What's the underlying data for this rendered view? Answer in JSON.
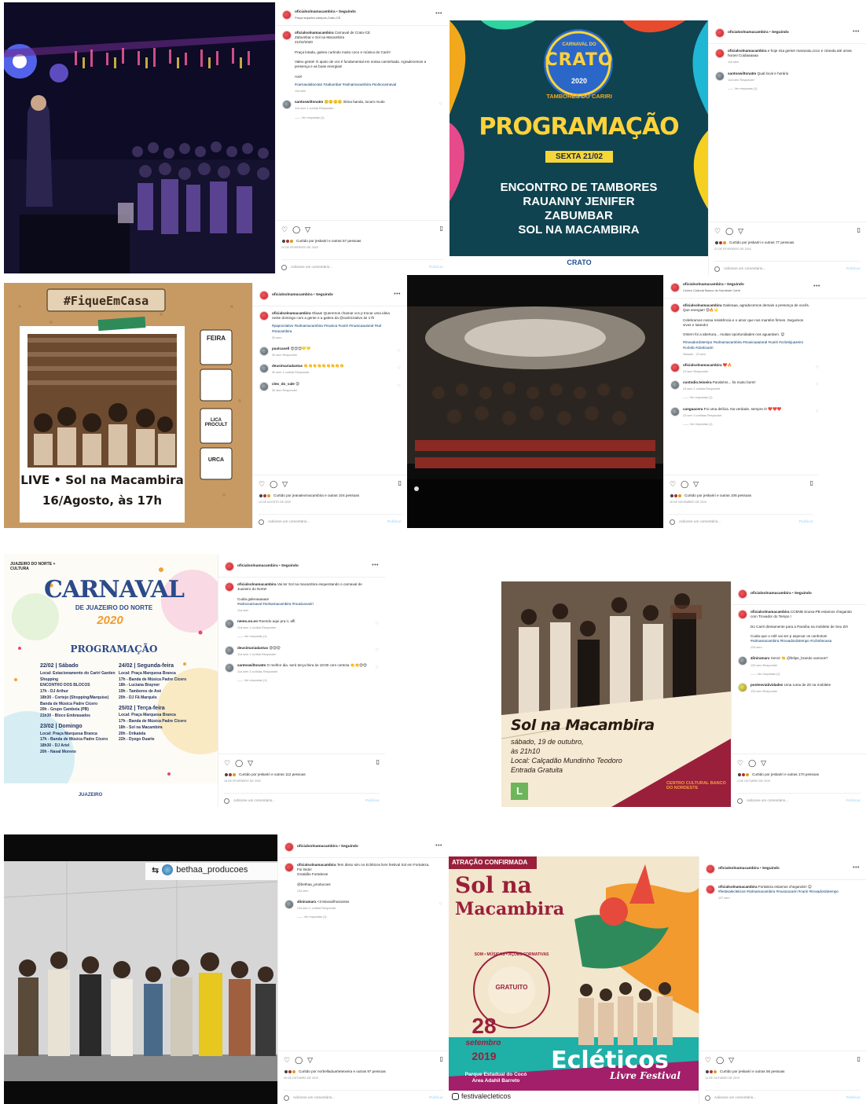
{
  "common": {
    "follow": "Seguindo",
    "add_comment": "Adicione um comentário...",
    "publish": "Publicar",
    "reply": "Responder",
    "view_replies": "Ver respostas (1)"
  },
  "posts": [
    {
      "user": "oficialsolnamacambira",
      "location": "Praça siqueira campos,Crato-CE",
      "caption": "Carnaval de Crato-CE\nZabumbar e Sol na Macambira\n21/02/2020\n\nPraça lotada, galera curtindo muito coco e música do Cariri!\n\nValeu gente! O apoio de vcs é fundamental em nossa caminhada. Agradecemos a presença e as boas energias!\n\nAxé!",
      "tags": "#carnavaldocrato #zabumbar #solnamacambira #solnocarnaval",
      "time": "11d sem",
      "comments": [
        {
          "user": "santoswiltonatm",
          "text": "🙂🙂🙂🙂 ótima banda, tocam muito",
          "meta": "11d sem   1 curtida   Responder",
          "more": "Ver respostas (1)"
        }
      ],
      "likes": "Curtido por jeskariri e outras 57 pessoas",
      "date": "24 DE FEVEREIRO DE 2020"
    },
    {
      "user": "oficialsolnamacambira",
      "caption": "e hoje mia gente! maracatu,coco e ciranda até umas horas! Cuidaaaaaa",
      "time": "11d sem",
      "comments": [
        {
          "user": "santoswiltonatm",
          "text": "Qual local e horário",
          "meta": "11d sem   Responder",
          "more": "Ver respostas (1)"
        }
      ],
      "likes": "Curtido por jeskariri e outras 77 pessoas",
      "date": "21 DE FEVEREIRO DE 2020",
      "poster": {
        "carnival": "CARNAVAL DO",
        "city": "CRATO",
        "year": "2020",
        "subtitle": "TAMBORES DO CARIRI",
        "title": "PROGRAMAÇÃO",
        "day": "SEXTA 21/02",
        "lineup": [
          "ENCONTRO DE TAMBORES",
          "RAUANNY JENIFER",
          "ZABUMBAR",
          "SOL NA MACAMBIRA"
        ],
        "footer": "CRATO"
      }
    },
    {
      "user": "oficialsolnamacambira",
      "caption": "Olaaa! Queremos chamar vcs p trocar uma ideia neste domingo com a gente e a galera da @cariricriativo às 17h",
      "tags": "#papocriativo #solnamacambira #musica #cariri #musicaautoral #sol #macambira",
      "time": "30 sem",
      "comments": [
        {
          "user": "paulcasell",
          "text": "😍😍😍💛💛",
          "meta": "30 sem   Responder"
        },
        {
          "user": "deusimariadantas",
          "text": "👏👏👏👏👏👏👏👏👏",
          "meta": "30 sem   1 curtida   Responder"
        },
        {
          "user": "cleo_do_vale",
          "text": "😍",
          "meta": "30 sem   Responder"
        }
      ],
      "likes": "Curtido por jeanalexmacambira e outras 104 pessoas",
      "date": "14 DE AGOSTO DE 2020",
      "poster": {
        "hashtag": "#FiqueEmCasa",
        "live": "LIVE • Sol na Macambira",
        "when": "16/Agosto, às 17h",
        "tags": [
          "FEIRA",
          "LICA PROCULT",
          "URCA"
        ]
      }
    },
    {
      "user": "oficialsolnamacambira",
      "location": "Centro Cultural Banco do Nordeste Cariri",
      "caption": "Galeraaa, agradecemos demais a presença de vocês. Que energia!! 😍🔥🌟\n\nCelebramos nossa resistência e o amor que nos mantém firmes. Seguimos vivos e lutando!\n\nOntem foi a abertura... muitas oportunidades nos aguardam. 😊",
      "tags": "#trovadordotempo #solnamacambira #musicaautoral #cariri #ccbnbjuazeiro #ccbnb #cbnbcariri",
      "time": "Sábado · 23 sem",
      "comments": [
        {
          "user": "oficialsolnamacambira",
          "text": "❤️🔥",
          "meta": "23 sem   Responder"
        },
        {
          "user": "custodio.teixeira",
          "text": "Parabéns... foi muito bom!!",
          "meta": "23 sem   1 curtida   Responder",
          "more": "Ver respostas (1)"
        },
        {
          "user": "cangaacera",
          "text": "Foi uma delícia. Na verdade, sempre é! ❤️❤️❤️",
          "meta": "23 sem   3 curtidas   Responder",
          "more": "Ver respostas (1)"
        }
      ],
      "likes": "Curtido por jeskariri e outras 106 pessoas",
      "date": "16 DE NOVEMBRO DE 2019"
    },
    {
      "user": "oficialsolnamacambira",
      "caption": "Vai ter Sol na macambira esquentando o carnaval de Juazeiro do Norte!\n\nCuida galeraaaaaa!",
      "tags": "#solnocarnaval #solnamacambira #musicacariri",
      "time": "11d sem",
      "comments": [
        {
          "user": "nemo.oo.oo",
          "text": "Roendo aqui pra ir, affi",
          "meta": "11d sem   1 curtida   Responder",
          "more": "Ver respostas (1)"
        },
        {
          "user": "deusimariadantas",
          "text": "😍😍😍",
          "meta": "11d sem   1 curtida   Responder"
        },
        {
          "user": "santoswiltonatm",
          "text": "O melhor dia. será terça-feira às 18:00 com certeza 👏👏😍😍",
          "meta": "11d sem   3 curtidas   Responder",
          "more": "Ver respostas (1)"
        }
      ],
      "likes": "Curtido por jeskariri e outras 112 pessoas",
      "date": "18 DE FEVEREIRO DE 2020",
      "poster": {
        "brand": "JUAZEIRO DO NORTE + CULTURA",
        "title": "CARNAVAL",
        "subtitle": "DE JUAZEIRO DO NORTE",
        "year": "2020",
        "program": "PROGRAMAÇÃO",
        "col1": [
          "22/02 | Sábado",
          "Local: Estacionamento do Cariri Garden Shopping",
          "ENCONTRO DOS BLOCOS",
          "17h - DJ Arthur",
          "18h30 - Cortejo (Shopping/Marquise)",
          "Banda de Música Padre Cícero",
          "20h - Grupo Cambeia (PB)",
          "21h30 - Bloco Embrasados",
          "23/02 | Domingo",
          "Local: Praça Marquesa Branca",
          "17h - Banda de Música Padre Cícero",
          "18h30 - DJ Ariel",
          "20h - Naval Moreno"
        ],
        "col2": [
          "24/02 | Segunda-feira",
          "Local: Praça Marquesa Branca",
          "17h - Banda de Música Padre Cícero",
          "18h - Luciana Brayner",
          "19h - Tambores de Axé",
          "20h - DJ Fã Marquês",
          "25/02 | Terça-feira",
          "Local: Praça Marquesa Branca",
          "17h - Banda de Música Padre Cícero",
          "18h - Sol na Macambira",
          "20h - Drikatela",
          "22h - Dyego Duarte"
        ],
        "logos": "JUAZEIRO"
      }
    },
    {
      "user": "oficialsolnamacambira",
      "caption": "CCBNB Sousa-PB estamos chegando com Trovador do Tempo !\n\nDo Cariri diretamente para a Paraíba na mobilete de Seu Zé!\n\nCuida que o rolê vai ser p aspecar os canhotos!",
      "tags": "#solnamacambira #trovadordotempo #ccbnbsousa",
      "time": "133 sem",
      "comments": [
        {
          "user": "4liniramarx",
          "text": "Xeroi! 👏 @felipe_brando vamoos?",
          "meta": "133 sem   Responder",
          "more": "Ver respostas (1)"
        },
        {
          "user": "pontesviatividades",
          "text": "Uma ruma de Zé na mobilete",
          "meta": "133 sem   Responder"
        }
      ],
      "likes": "Curtido por jeskariri e outras 170 pessoas",
      "date": "4 DE OUTUBRO DE 2019",
      "poster": {
        "band": "Sol na Macambira",
        "line1": "sábado, 19 de outubro,",
        "line2": "às 21h10",
        "line3": "Local: Calçadão Mundinho Teodoro",
        "line4": "Entrada Gratuita",
        "sponsor": "CENTRO CULTURAL BANCO DO NORDESTE",
        "rating": "L"
      }
    },
    {
      "user": "oficialsolnamacambira",
      "caption": "Tem disso sim no Ecléticos livre festival Sol em Fortaleza.\nFoi lindo!\nGratidão Fortaleza!\n\n@bethaa_producoes",
      "time": "134 sem",
      "comments": [
        {
          "user": "4liniramarx",
          "text": "<3 Maravilhosossss",
          "meta": "134 sem   1 curtida   Responder",
          "more": "Ver respostas (1)"
        }
      ],
      "likes": "Curtido por norbelladuarteteixeira e outras 97 pessoas",
      "date": "30 DE OUTUBRO DE 2019",
      "repost": "bethaa_producoes"
    },
    {
      "user": "oficialsolnamacambira",
      "caption": "Fortaleza estamos chegando!! 😊",
      "tags": "#festivalecleticos #solnamacambira #musicacariri #cariri #trovadordotempo",
      "time": "137 sem",
      "comments": [],
      "likes": "Curtido por jeskariri e outras 56 pessoas",
      "date": "14 DE OUTUBRO DE 2019",
      "poster": {
        "banner": "ATRAÇÃO CONFIRMADA",
        "band1": "Sol na",
        "band2": "Macambira",
        "badge": "GRATUITO",
        "ring": "SOM • MÚSICAS • AÇÕES FORMATIVAS",
        "date1": "28",
        "date2": "setembro",
        "date3": "2019",
        "place": "Parque Estadual do Cocó\nArea Adahil Barreto",
        "festival": "Ecléticos",
        "festival2": "Livre Festival",
        "handle": "festivalecleticos"
      }
    }
  ]
}
